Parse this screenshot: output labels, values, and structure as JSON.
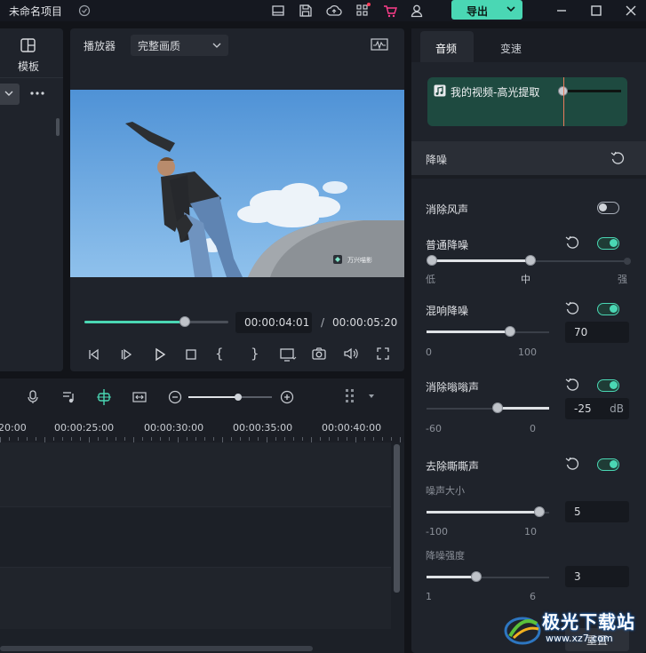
{
  "app": {
    "project_title": "未命名项目",
    "export_label": "导出"
  },
  "left_panel": {
    "template_label": "模板"
  },
  "player": {
    "label": "播放器",
    "quality": "完整画质",
    "watermark": "万兴喵影",
    "current_time": "00:00:04:01",
    "separator": "/",
    "total_time": "00:00:05:20",
    "progress": 0.7
  },
  "timeline": {
    "ruler": [
      "20:00",
      "00:00:25:00",
      "00:00:30:00",
      "00:00:35:00",
      "00:00:40:00"
    ],
    "zoom_level": 0.6
  },
  "right_panel": {
    "tabs": [
      {
        "label": "音频",
        "active": true
      },
      {
        "label": "变速",
        "active": false
      }
    ],
    "clip_name": "我的视频-高光提取",
    "section_title": "降噪",
    "wind": {
      "label": "消除风声",
      "enabled": false
    },
    "normal": {
      "label": "普通降噪",
      "enabled": true,
      "level": 0.5,
      "low": "低",
      "mid": "中",
      "high": "强"
    },
    "reverb": {
      "label": "混响降噪",
      "enabled": true,
      "value": "70",
      "min": "0",
      "max": "100"
    },
    "hum": {
      "label": "消除嗡嗡声",
      "enabled": true,
      "value": "-25",
      "unit": "dB",
      "min": "-60",
      "max": "0"
    },
    "hiss": {
      "label": "去除嘶嘶声",
      "enabled": true,
      "volume_label": "噪声大小",
      "volume_value": "5",
      "volume_min": "-100",
      "volume_max": "10",
      "strength_label": "降噪强度",
      "strength_value": "3",
      "strength_min": "1",
      "strength_max": "6"
    },
    "reset_label": "重置"
  },
  "watermark_site": {
    "name": "极光下载站",
    "url": "www.xz7.com"
  },
  "colors": {
    "accent": "#4ad7b4",
    "panel": "#1f232b",
    "background": "#121419"
  }
}
